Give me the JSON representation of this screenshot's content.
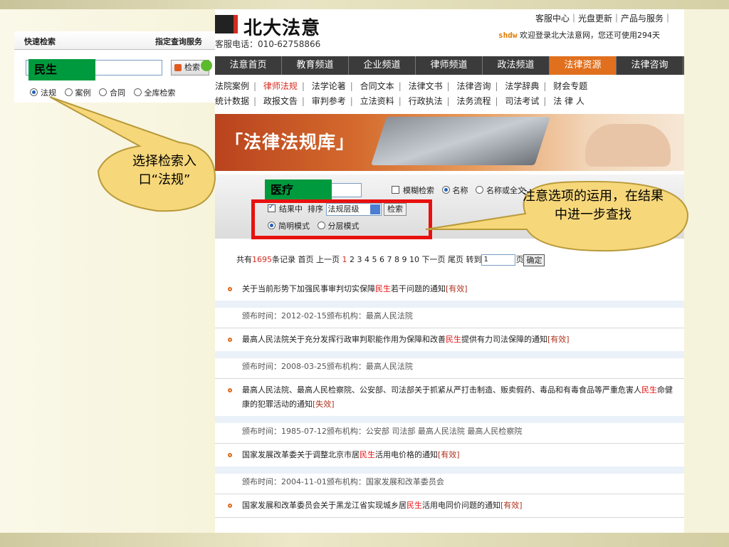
{
  "quick_search": {
    "title": "快速检索",
    "designated": "指定查询服务",
    "input_value": "",
    "button_label": "检索",
    "tag": "民生",
    "scopes": [
      {
        "label": "法规",
        "checked": true
      },
      {
        "label": "案例",
        "checked": false
      },
      {
        "label": "合同",
        "checked": false
      },
      {
        "label": "全库检索",
        "checked": false
      }
    ]
  },
  "header": {
    "logo": "北大法意",
    "hotline": "客服电话：010-62758866",
    "links": "客服中心｜光盘更新｜产品与服务｜",
    "user": "shdw",
    "welcome": "欢迎登录北大法意网，您还可使用294天"
  },
  "nav": [
    "法意首页",
    "教育频道",
    "企业频道",
    "律师频道",
    "政法频道",
    "法律资源",
    "法律咨询"
  ],
  "nav_active": "法律资源",
  "subnav": {
    "row1": [
      "法院案例",
      "律师法规",
      "法学论著",
      "合同文本",
      "法律文书",
      "法律咨询",
      "法学辞典",
      "财会专题"
    ],
    "row1_active": "律师法规",
    "row2": [
      "统计数据",
      "政报文告",
      "审判参考",
      "立法资料",
      "行政执法",
      "法务流程",
      "司法考试",
      "法 律 人"
    ]
  },
  "banner_title": "「法律法规库」",
  "search": {
    "tag": "医疗",
    "fuzzy": "模糊检索",
    "name": "名称",
    "name_full": "名称或全文",
    "in_results": "结果中",
    "sort": "排序",
    "sort_value": "法规层级",
    "button": "检索",
    "mode_simple": "简明模式",
    "mode_layer": "分层模式"
  },
  "pager": {
    "prefix": "共有",
    "count": "1695",
    "suffix": "条记录",
    "first": "首页",
    "prev": "上一页",
    "current": "1",
    "pages": "2 3 4 5 6 7 8 9 10",
    "next": "下一页",
    "last": "尾页",
    "goto": "转到",
    "goto_value": "1",
    "page_unit": "页",
    "confirm": "确定"
  },
  "results": [
    {
      "pre": "关于当前形势下加强民事审判切实保障",
      "hl": "民生",
      "post": "若干问题的通知",
      "status": "[有效]",
      "meta": "颁布时间：2012-02-15颁布机构：最高人民法院"
    },
    {
      "pre": "最高人民法院关于充分发挥行政审判职能作用为保障和改善",
      "hl": "民生",
      "post": "提供有力司法保障的通知",
      "status": "[有效]",
      "meta": "颁布时间：2008-03-25颁布机构：最高人民法院"
    },
    {
      "pre": "最高人民法院、最高人民检察院、公安部、司法部关于抓紧从严打击制造、贩卖假药、毒品和有毒食品等严重危害人",
      "hl": "民生",
      "post": "命健康的犯罪活动的通知",
      "status": "[失效]",
      "meta": "颁布时间：1985-07-12颁布机构：公安部 司法部 最高人民法院 最高人民检察院"
    },
    {
      "pre": "国家发展改革委关于调整北京市居",
      "hl": "民生",
      "post": "活用电价格的通知",
      "status": "[有效]",
      "meta": "颁布时间：2004-11-01颁布机构：国家发展和改革委员会"
    },
    {
      "pre": "国家发展和改革委员会关于黑龙江省实现城乡居",
      "hl": "民生",
      "post": "活用电同价问题的通知",
      "status": "[有效]",
      "meta": ""
    }
  ],
  "callouts": {
    "left": "选择检索入口“法规”",
    "right": "注意选项的运用，在结果中进一步查找"
  },
  "colors": {
    "tag_green": "#009a3e",
    "highlight_red": "#e8110f",
    "nav_active": "#e0701e",
    "callout_fill": "#f6d77a"
  }
}
